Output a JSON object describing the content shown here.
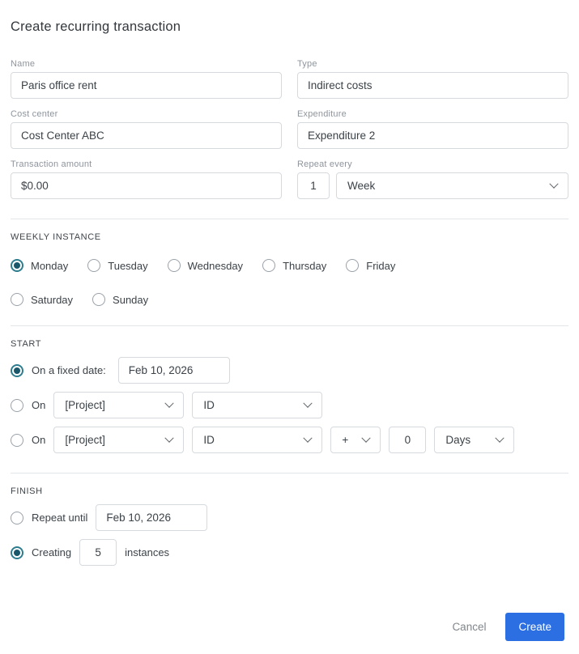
{
  "title": "Create recurring transaction",
  "colors": {
    "accent_blue": "#2b6fe3",
    "radio_selected_ring": "#2e7d8f",
    "radio_selected_dot": "#19576b",
    "input_border": "#d6dade"
  },
  "fields": {
    "name": {
      "label": "Name",
      "value": "Paris office rent"
    },
    "type": {
      "label": "Type",
      "value": "Indirect costs"
    },
    "cost_center": {
      "label": "Cost center",
      "value": "Cost Center ABC"
    },
    "expenditure": {
      "label": "Expenditure",
      "value": "Expenditure 2"
    },
    "transaction_amount": {
      "label": "Transaction amount",
      "value": "$0.00"
    },
    "repeat_every": {
      "label": "Repeat every",
      "count": "1",
      "unit": "Week"
    }
  },
  "weekly_instance": {
    "heading": "WEEKLY INSTANCE",
    "days_row1": [
      {
        "label": "Monday",
        "selected": true
      },
      {
        "label": "Tuesday",
        "selected": false
      },
      {
        "label": "Wednesday",
        "selected": false
      },
      {
        "label": "Thursday",
        "selected": false
      },
      {
        "label": "Friday",
        "selected": false
      }
    ],
    "days_row2": [
      {
        "label": "Saturday",
        "selected": false
      },
      {
        "label": "Sunday",
        "selected": false
      }
    ]
  },
  "start": {
    "heading": "START",
    "fixed_date": {
      "label": "On a fixed date:",
      "value": "Feb 10, 2026",
      "selected": true
    },
    "on_row1": {
      "label": "On",
      "project": "[Project]",
      "field": "ID",
      "selected": false
    },
    "on_row2": {
      "label": "On",
      "project": "[Project]",
      "field": "ID",
      "operator": "+",
      "offset": "0",
      "unit": "Days",
      "selected": false
    }
  },
  "finish": {
    "heading": "FINISH",
    "repeat_until": {
      "label": "Repeat until",
      "value": "Feb 10, 2026",
      "selected": false
    },
    "creating": {
      "label": "Creating",
      "count": "5",
      "suffix": "instances",
      "selected": true
    }
  },
  "footer": {
    "cancel_label": "Cancel",
    "create_label": "Create"
  }
}
